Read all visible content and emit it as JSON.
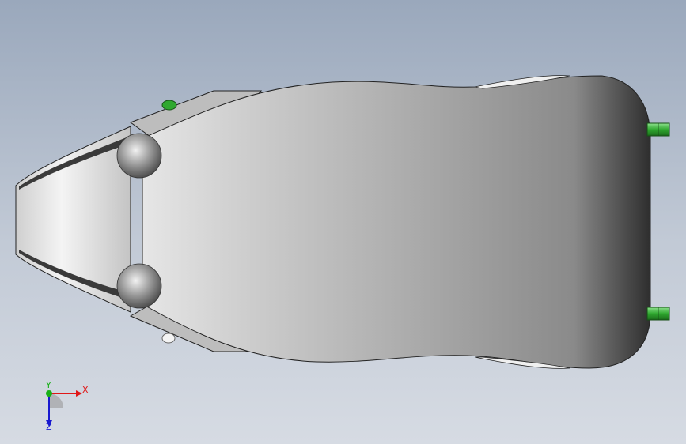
{
  "viewport": {
    "background_top": "#9aa8bc",
    "background_bottom": "#d6dbe3"
  },
  "model": {
    "body_color": "#a8a8a8",
    "pin_color": "#2fa82f",
    "ball_color": "#8c8c8c"
  },
  "triad": {
    "x_label": "X",
    "y_label": "Y",
    "z_label": "Z",
    "x_color": "#e01818",
    "y_color": "#18b018",
    "z_color": "#1818d0"
  }
}
